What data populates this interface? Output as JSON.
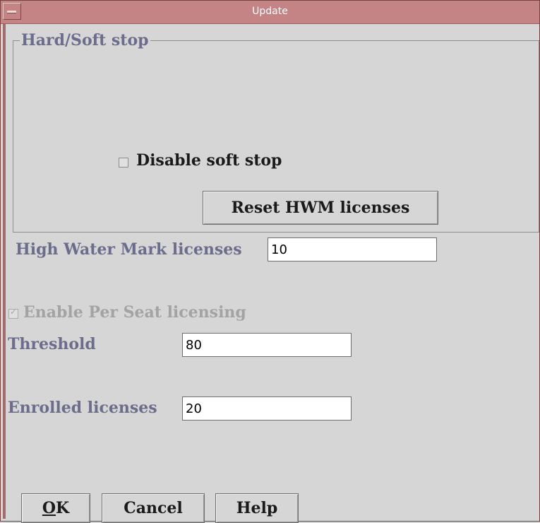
{
  "window": {
    "title": "Update"
  },
  "hard_soft": {
    "group_title": "Hard/Soft stop",
    "disable_soft_stop_label": "Disable soft stop",
    "disable_soft_stop_checked": false,
    "reset_button": "Reset HWM licenses"
  },
  "hwm": {
    "label": "High Water Mark licenses",
    "value": "10"
  },
  "per_seat": {
    "label": "Enable Per Seat licensing",
    "checked": true,
    "enabled": false
  },
  "threshold": {
    "label": "Threshold",
    "value": "80"
  },
  "enrolled": {
    "label": "Enrolled licenses",
    "value": "20"
  },
  "buttons": {
    "ok_mnemonic": "O",
    "ok_rest": "K",
    "cancel": "Cancel",
    "help": "Help"
  },
  "colors": {
    "titlebar": "#c48486",
    "label": "#6c6c8c",
    "background": "#d6d6d6"
  }
}
